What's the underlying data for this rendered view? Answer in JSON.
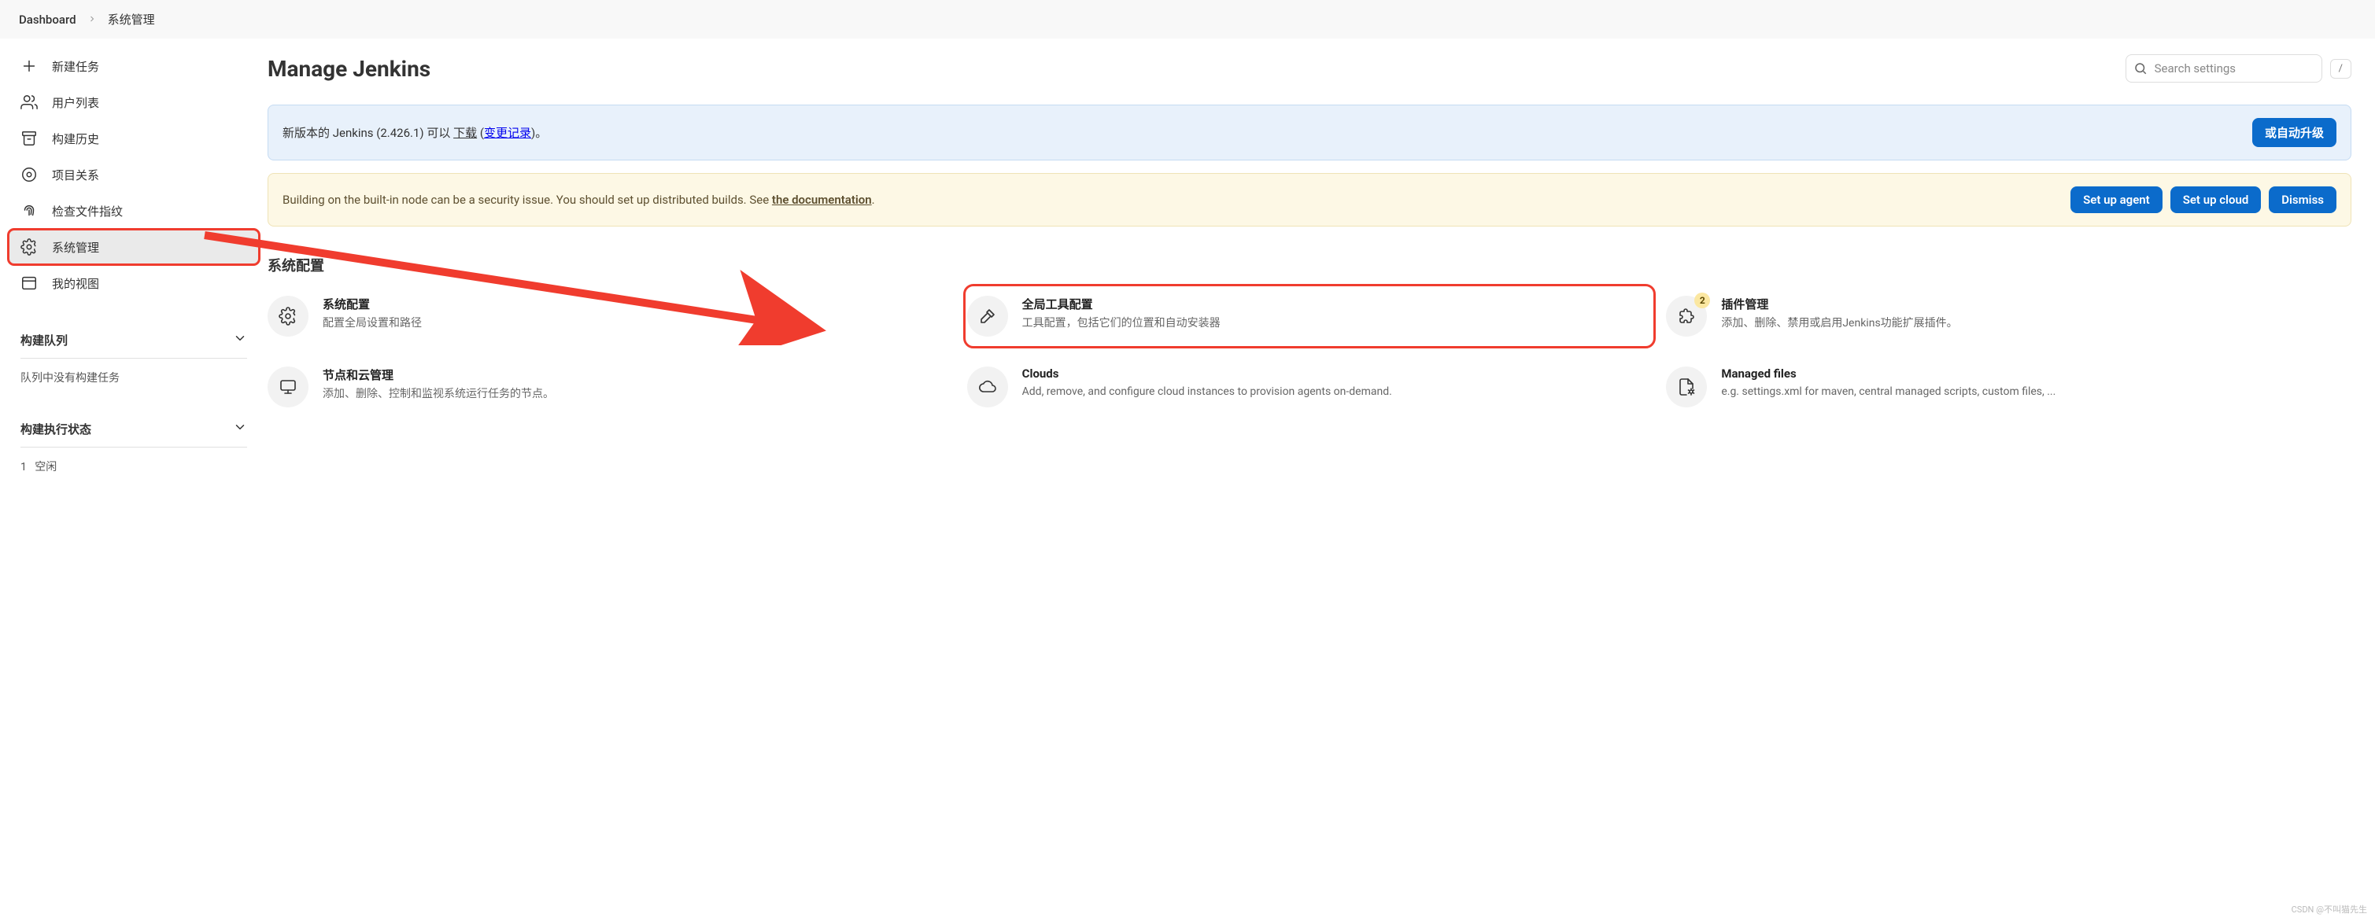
{
  "breadcrumb": {
    "root": "Dashboard",
    "current": "系统管理"
  },
  "sidebar": {
    "items": [
      {
        "label": "新建任务"
      },
      {
        "label": "用户列表"
      },
      {
        "label": "构建历史"
      },
      {
        "label": "项目关系"
      },
      {
        "label": "检查文件指纹"
      },
      {
        "label": "系统管理"
      },
      {
        "label": "我的视图"
      }
    ],
    "queue": {
      "title": "构建队列",
      "empty": "队列中没有构建任务"
    },
    "exec": {
      "title": "构建执行状态",
      "idle_num": "1",
      "idle_label": "空闲"
    }
  },
  "header": {
    "title": "Manage Jenkins"
  },
  "search": {
    "placeholder": "Search settings",
    "shortcut": "/"
  },
  "notices": {
    "update": {
      "prefix": "新版本的 Jenkins (2.426.1) 可以",
      "download": "下载",
      "open_paren": " (",
      "changelog": "变更记录",
      "close": ")。",
      "button": "或自动升级"
    },
    "security": {
      "text": "Building on the built-in node can be a security issue. You should set up distributed builds. See ",
      "doclink": "the documentation",
      "period": ".",
      "btn_agent": "Set up agent",
      "btn_cloud": "Set up cloud",
      "btn_dismiss": "Dismiss"
    }
  },
  "section": {
    "title": "系统配置"
  },
  "tiles": [
    {
      "title": "系统配置",
      "desc": "配置全局设置和路径"
    },
    {
      "title": "全局工具配置",
      "desc": "工具配置，包括它们的位置和自动安装器"
    },
    {
      "title": "插件管理",
      "desc": "添加、删除、禁用或启用Jenkins功能扩展插件。",
      "badge": "2"
    },
    {
      "title": "节点和云管理",
      "desc": "添加、删除、控制和监视系统运行任务的节点。"
    },
    {
      "title": "Clouds",
      "desc": "Add, remove, and configure cloud instances to provision agents on-demand."
    },
    {
      "title": "Managed files",
      "desc": "e.g. settings.xml for maven, central managed scripts, custom files, ..."
    }
  ],
  "watermark": "CSDN @不叫猫先生"
}
